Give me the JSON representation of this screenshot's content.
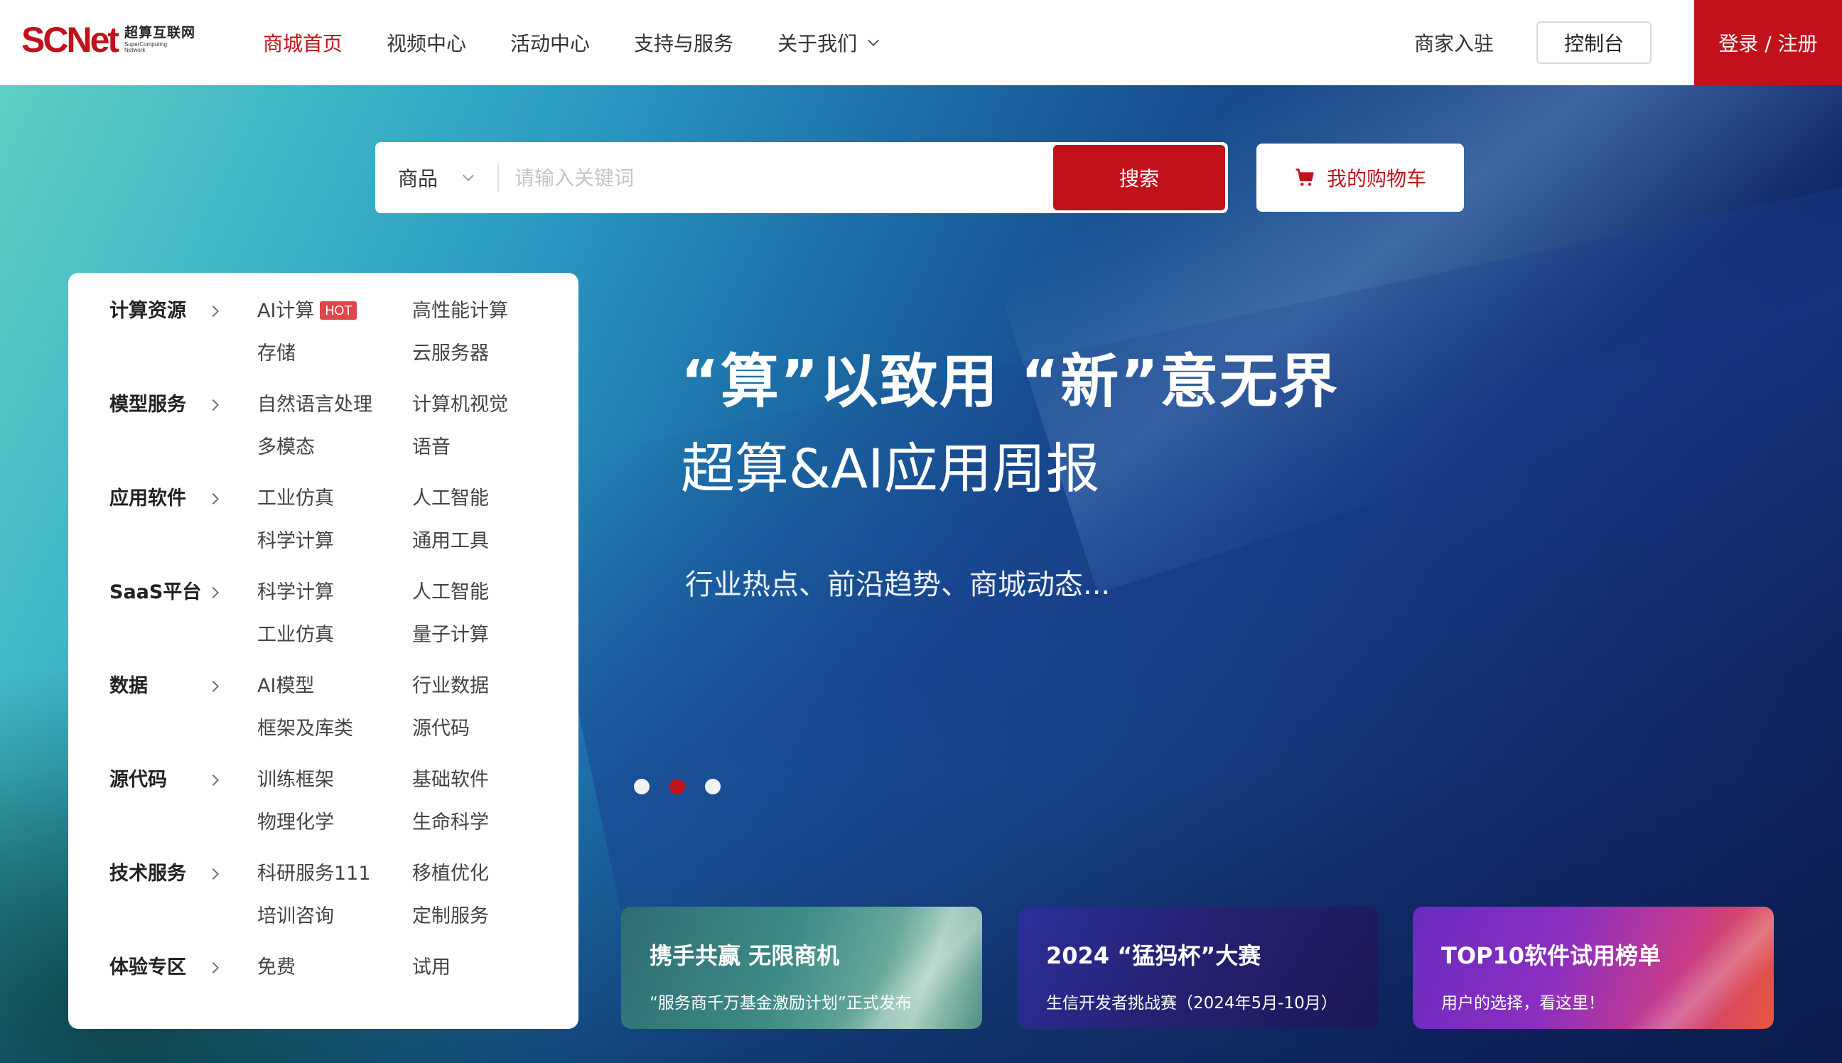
{
  "brand": {
    "logo_mark": "SCNet",
    "logo_cn": "超算互联网",
    "logo_en_1": "SuperComputing",
    "logo_en_2": "Network",
    "accent_color": "#c1121c"
  },
  "nav": {
    "items": [
      {
        "label": "商城首页",
        "active": true
      },
      {
        "label": "视频中心",
        "active": false
      },
      {
        "label": "活动中心",
        "active": false
      },
      {
        "label": "支持与服务",
        "active": false
      },
      {
        "label": "关于我们",
        "active": false,
        "dropdown": true
      }
    ],
    "merchant": "商家入驻",
    "console": "控制台",
    "login": "登录 / 注册"
  },
  "search": {
    "type_selected": "商品",
    "placeholder": "请输入关键词",
    "button": "搜索",
    "cart": "我的购物车"
  },
  "categories": [
    {
      "title": "计算资源",
      "links": [
        "AI计算",
        "高性能计算",
        "存储",
        "云服务器"
      ],
      "hot_badge": "HOT"
    },
    {
      "title": "模型服务",
      "links": [
        "自然语言处理",
        "计算机视觉",
        "多模态",
        "语音"
      ]
    },
    {
      "title": "应用软件",
      "links": [
        "工业仿真",
        "人工智能",
        "科学计算",
        "通用工具"
      ]
    },
    {
      "title": "SaaS平台",
      "links": [
        "科学计算",
        "人工智能",
        "工业仿真",
        "量子计算"
      ]
    },
    {
      "title": "数据",
      "links": [
        "AI模型",
        "行业数据",
        "框架及库类",
        "源代码"
      ]
    },
    {
      "title": "源代码",
      "links": [
        "训练框架",
        "基础软件",
        "物理化学",
        "生命科学"
      ]
    },
    {
      "title": "技术服务",
      "links": [
        "科研服务111",
        "移植优化",
        "培训咨询",
        "定制服务"
      ]
    },
    {
      "title": "体验专区",
      "links": [
        "免费",
        "试用"
      ]
    }
  ],
  "hero": {
    "title_line1": "“算”以致用 “新”意无界",
    "title_line2": "超算&AI应用周报",
    "subtitle": "行业热点、前沿趋势、商城动态...",
    "carousel_total": 3,
    "carousel_active": 2
  },
  "promos": [
    {
      "title": "携手共赢 无限商机",
      "sub": "“服务商千万基金激励计划”正式发布"
    },
    {
      "title": "2024 “猛犸杯”大赛",
      "sub": "生信开发者挑战赛（2024年5月-10月）"
    },
    {
      "title": "TOP10软件试用榜单",
      "sub": "用户的选择，看这里！"
    }
  ]
}
